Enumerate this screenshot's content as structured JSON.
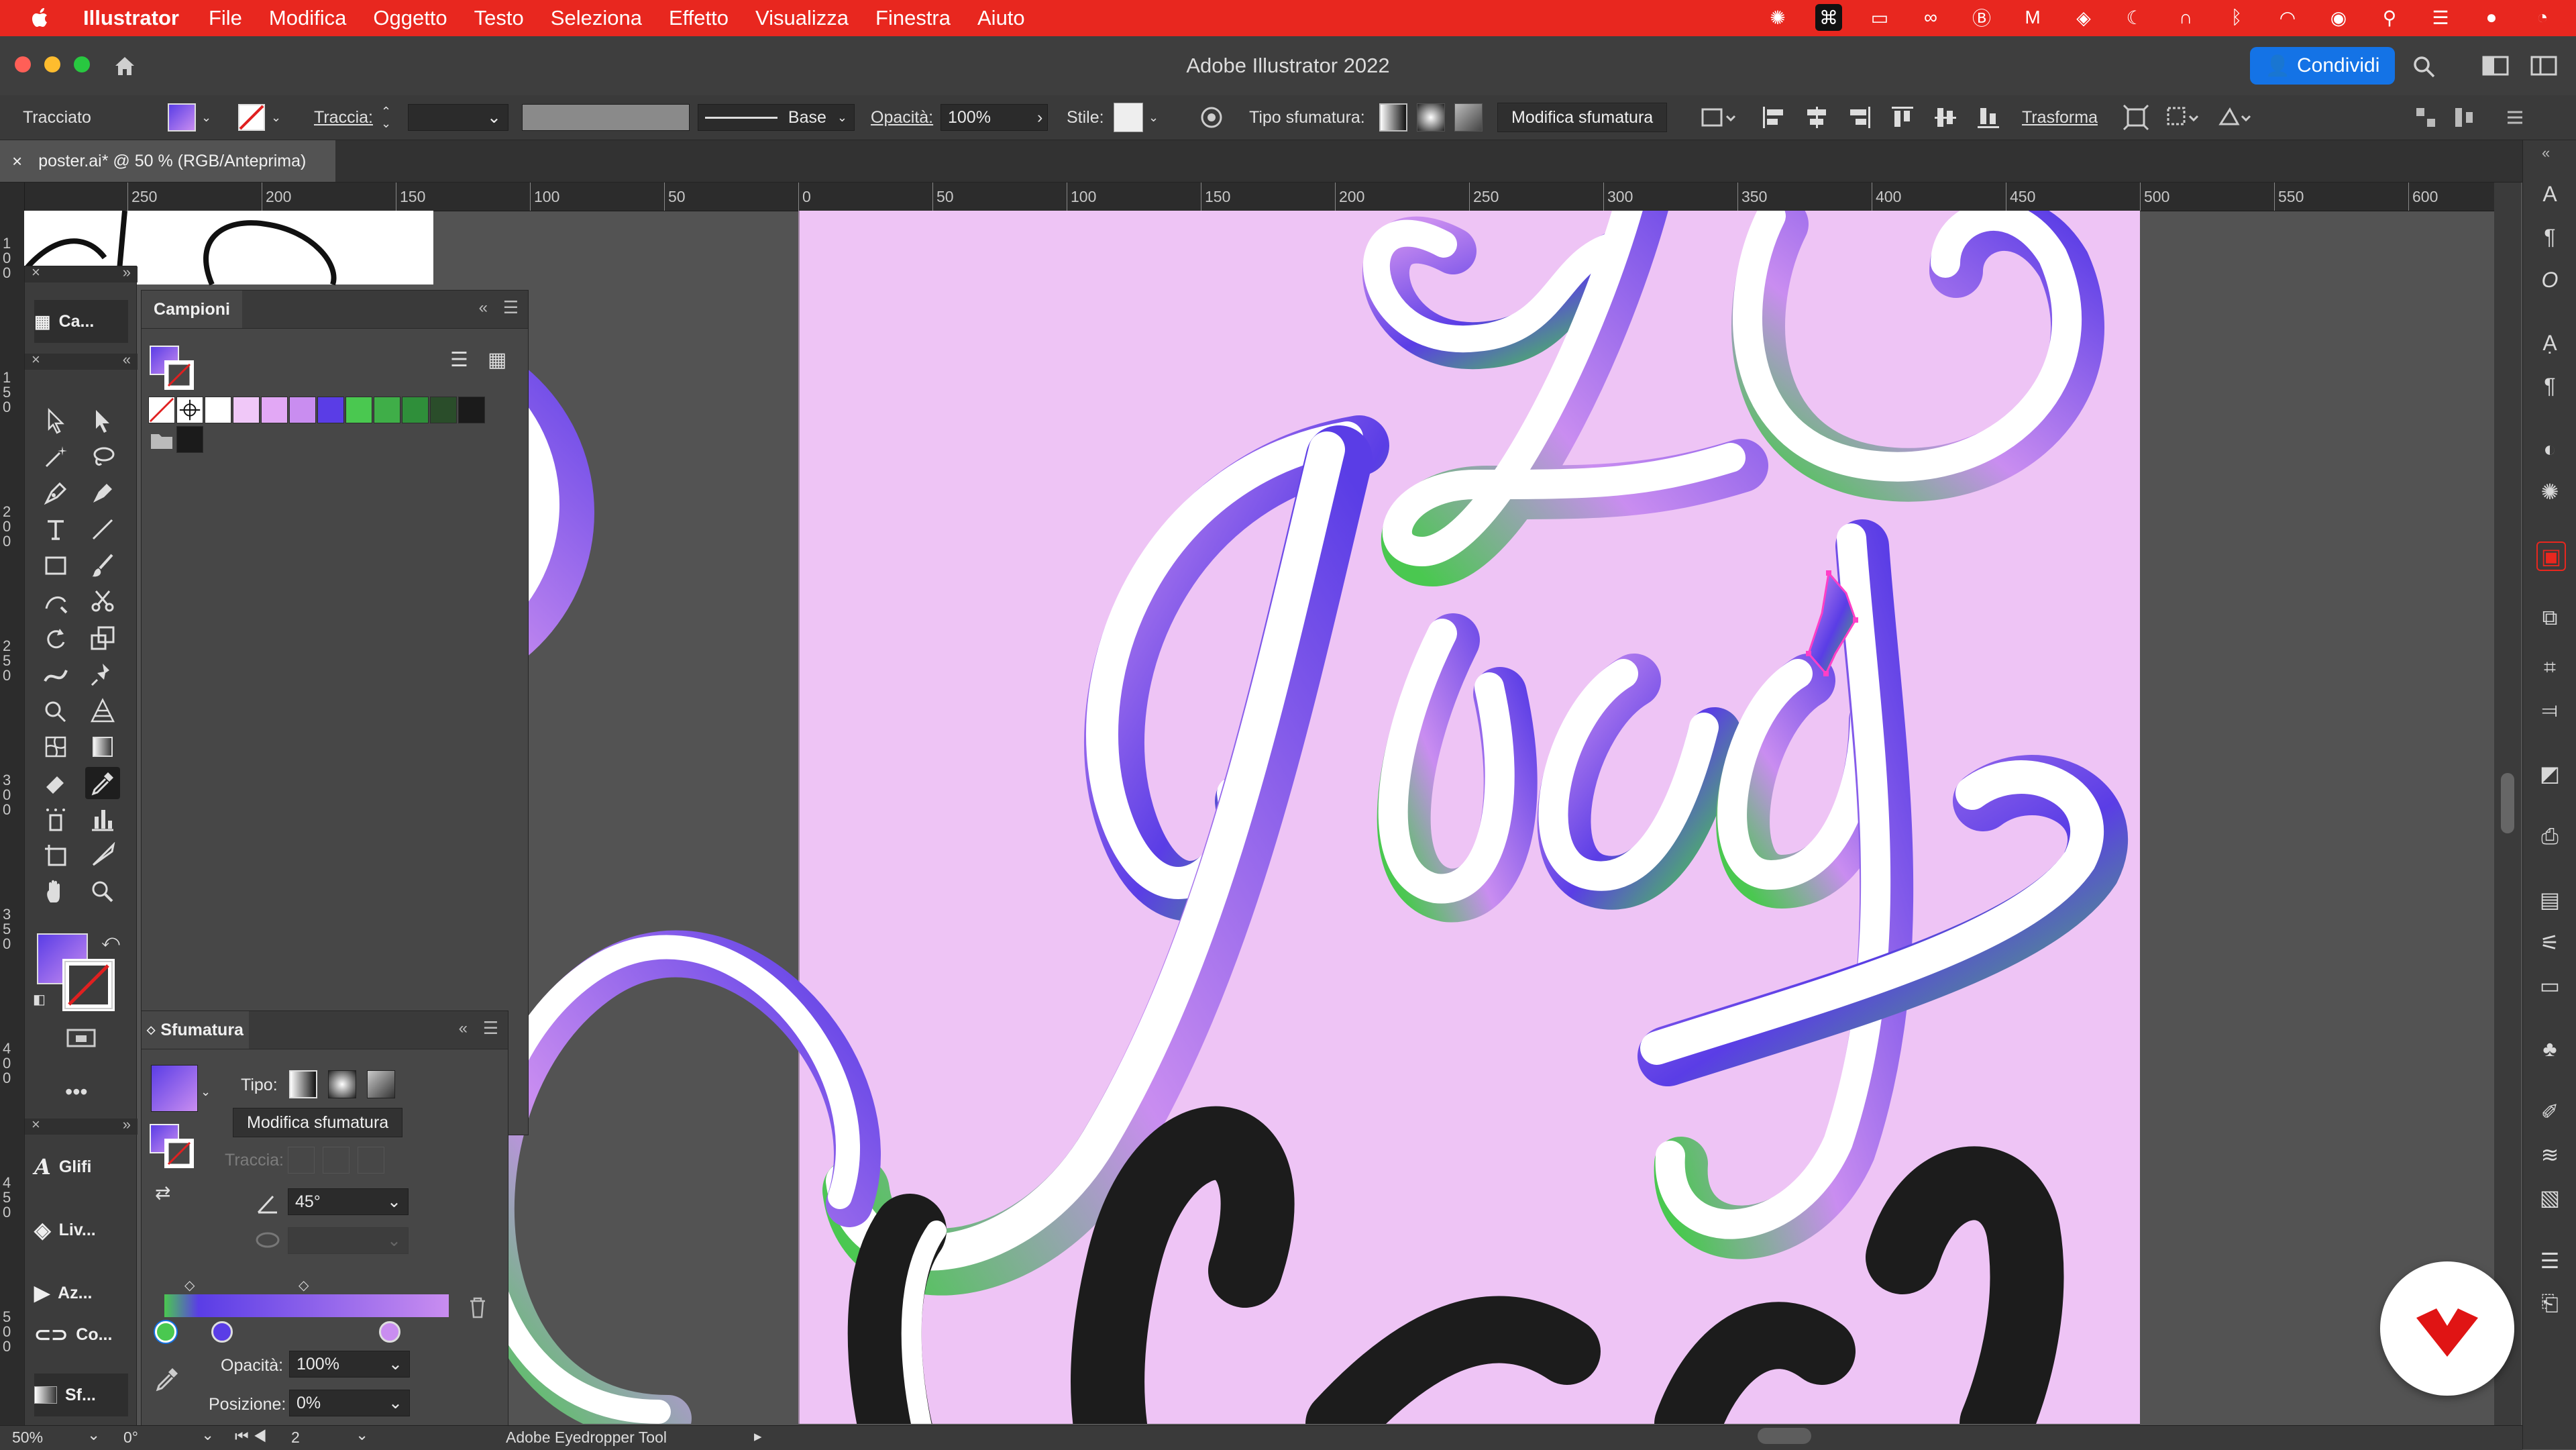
{
  "menubar": {
    "app_name": "Illustrator",
    "items": [
      "File",
      "Modifica",
      "Oggetto",
      "Testo",
      "Seleziona",
      "Effetto",
      "Visualizza",
      "Finestra",
      "Aiuto"
    ]
  },
  "window": {
    "title": "Adobe Illustrator 2022",
    "share_label": "Condividi"
  },
  "controlbar": {
    "selection_type": "Tracciato",
    "stroke_label": "Traccia:",
    "brush_label": "Base",
    "opacity_label": "Opacità:",
    "opacity_value": "100%",
    "style_label": "Stile:",
    "gradient_type_label": "Tipo sfumatura:",
    "edit_gradient_label": "Modifica sfumatura",
    "transform_label": "Trasforma"
  },
  "document": {
    "tab_label": "poster.ai* @ 50 % (RGB/Anteprima)"
  },
  "ruler": {
    "h_labels": [
      "250",
      "200",
      "150",
      "100",
      "50",
      "0",
      "50",
      "100",
      "150",
      "200",
      "250",
      "300",
      "350",
      "400",
      "450",
      "500",
      "550",
      "600"
    ],
    "v_labels": [
      "100",
      "150",
      "200",
      "250",
      "300",
      "350",
      "400",
      "450",
      "500"
    ]
  },
  "tools_panel": {
    "collapsed_panels": [
      {
        "label": "Ca...",
        "icon": "libraries-icon"
      },
      {
        "label": "Glifi",
        "icon": "glyphs-icon"
      },
      {
        "label": "Liv...",
        "icon": "layers-icon"
      },
      {
        "label": "Az...",
        "icon": "actions-icon"
      },
      {
        "label": "Co...",
        "icon": "links-icon"
      },
      {
        "label": "Sf...",
        "icon": "gradient-panel-icon"
      }
    ]
  },
  "swatches_panel": {
    "title": "Campioni",
    "swatch_colors": [
      "none",
      "registration",
      "#ffffff",
      "#f0c8f8",
      "#e2a8f5",
      "#c98df0",
      "#5a3de6",
      "#4ac850",
      "#3fae48",
      "#2f8f3a",
      "#2a4d2a",
      "#1b1b1b"
    ]
  },
  "gradient_panel": {
    "title": "Sfumatura",
    "type_label": "Tipo:",
    "edit_label": "Modifica sfumatura",
    "stroke_label": "Traccia:",
    "angle_value": "45°",
    "opacity_label": "Opacità:",
    "opacity_value": "100%",
    "position_label": "Posizione:",
    "position_value": "0%",
    "stops": [
      "#4ac850",
      "#5a3de6",
      "#c98df0"
    ]
  },
  "statusbar": {
    "zoom": "50%",
    "rotation": "0°",
    "artboard": "2",
    "tool_name": "Adobe Eyedropper Tool"
  },
  "colors": {
    "menubar": "#e8271f",
    "artboard": "#eec4f5",
    "accent": "#1473e6",
    "gradient_purple": "#5a3de6",
    "gradient_green": "#4ac850"
  }
}
